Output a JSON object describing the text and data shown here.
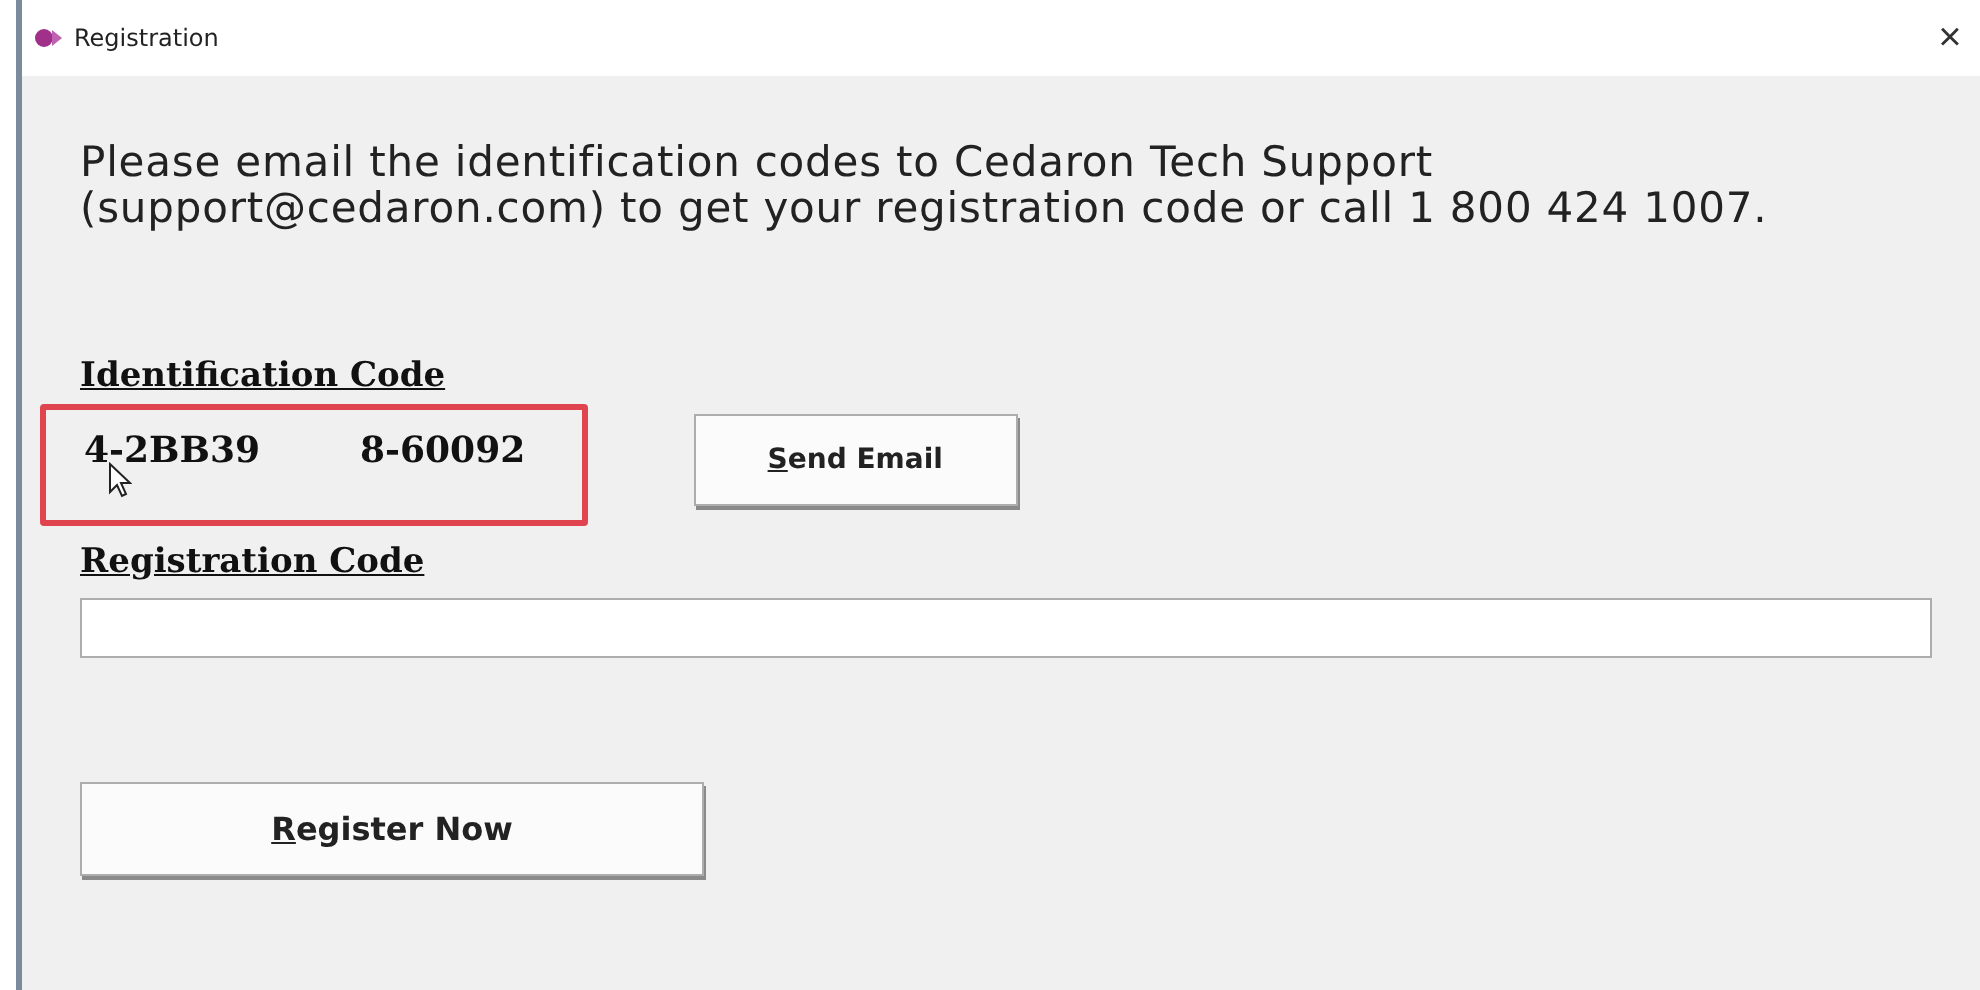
{
  "window": {
    "title": "Registration",
    "close": "×"
  },
  "message": "Please email the identification codes to Cedaron Tech Support (support@cedaron.com) to get your registration code or call 1 800 424 1007.",
  "identification": {
    "heading": "Identification Code",
    "codes": [
      "4-2BB39",
      "8-60092"
    ],
    "highlighted": true
  },
  "send_button": "Send Email",
  "registration": {
    "heading": "Registration Code"
  },
  "register_button": "Register Now"
}
